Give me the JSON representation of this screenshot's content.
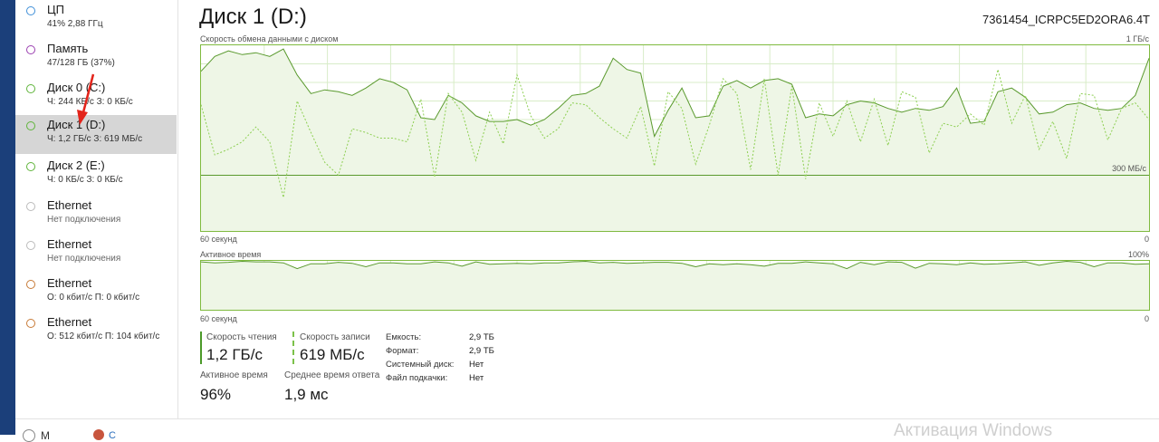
{
  "sidebar": {
    "items": [
      {
        "title": "ЦП",
        "sub": "41% 2,88 ГГц",
        "color": "#3f8fd8"
      },
      {
        "title": "Память",
        "sub": "47/128 ГБ (37%)",
        "color": "#9b3fb0"
      },
      {
        "title": "Диск 0 (C:)",
        "sub": "Ч: 244 КБ/с З: 0 КБ/с",
        "color": "#5fb43a"
      },
      {
        "title": "Диск 1 (D:)",
        "sub": "Ч: 1,2 ГБ/с З: 619 МБ/с",
        "color": "#5fb43a",
        "selected": true
      },
      {
        "title": "Диск 2 (E:)",
        "sub": "Ч: 0 КБ/с З: 0 КБ/с",
        "color": "#5fb43a"
      },
      {
        "title": "Ethernet",
        "sub": "Нет подключения",
        "color": "#bbbbbb"
      },
      {
        "title": "Ethernet",
        "sub": "Нет подключения",
        "color": "#bbbbbb"
      },
      {
        "title": "Ethernet",
        "sub": "О: 0 кбит/с П: 0 кбит/с",
        "color": "#c77a36"
      },
      {
        "title": "Ethernet",
        "sub": "О: 512 кбит/с П: 104 кбит/с",
        "color": "#c77a36"
      }
    ]
  },
  "header": {
    "title": "Диск 1 (D:)",
    "model": "7361454_ICRPC5ED2ORA6.4T"
  },
  "transfer_graph": {
    "label": "Скорость обмена данными с диском",
    "max_label": "1 ГБ/с",
    "mid_label": "300 МБ/с",
    "mid_fraction": 0.3,
    "time_label": "60 секунд",
    "zero_label": "0",
    "read_series": [
      0.86,
      0.94,
      0.97,
      0.95,
      0.96,
      0.94,
      0.98,
      0.84,
      0.74,
      0.76,
      0.75,
      0.73,
      0.77,
      0.82,
      0.8,
      0.76,
      0.61,
      0.6,
      0.73,
      0.69,
      0.62,
      0.59,
      0.59,
      0.6,
      0.57,
      0.6,
      0.66,
      0.73,
      0.74,
      0.78,
      0.93,
      0.87,
      0.85,
      0.51,
      0.65,
      0.77,
      0.61,
      0.62,
      0.78,
      0.81,
      0.77,
      0.81,
      0.82,
      0.79,
      0.61,
      0.63,
      0.62,
      0.68,
      0.7,
      0.69,
      0.66,
      0.64,
      0.66,
      0.65,
      0.67,
      0.77,
      0.58,
      0.59,
      0.75,
      0.77,
      0.72,
      0.63,
      0.64,
      0.68,
      0.69,
      0.66,
      0.65,
      0.66,
      0.73,
      0.93
    ],
    "write_series": [
      0.68,
      0.41,
      0.44,
      0.48,
      0.56,
      0.48,
      0.18,
      0.7,
      0.53,
      0.37,
      0.3,
      0.55,
      0.53,
      0.5,
      0.5,
      0.48,
      0.71,
      0.29,
      0.74,
      0.64,
      0.38,
      0.64,
      0.47,
      0.84,
      0.62,
      0.5,
      0.55,
      0.69,
      0.68,
      0.61,
      0.55,
      0.5,
      0.67,
      0.35,
      0.75,
      0.66,
      0.36,
      0.57,
      0.82,
      0.74,
      0.33,
      0.82,
      0.3,
      0.78,
      0.28,
      0.69,
      0.51,
      0.7,
      0.48,
      0.71,
      0.46,
      0.75,
      0.72,
      0.42,
      0.58,
      0.56,
      0.63,
      0.57,
      0.87,
      0.58,
      0.73,
      0.44,
      0.59,
      0.39,
      0.74,
      0.73,
      0.49,
      0.66,
      0.69,
      0.6
    ]
  },
  "active_graph": {
    "label": "Активное время",
    "max_label": "100%",
    "time_label": "60 секунд",
    "zero_label": "0",
    "series": [
      0.98,
      0.96,
      0.97,
      0.99,
      0.98,
      0.98,
      0.96,
      0.84,
      0.94,
      0.94,
      0.97,
      0.95,
      0.88,
      0.96,
      0.96,
      0.94,
      0.94,
      0.98,
      0.96,
      0.89,
      0.98,
      0.93,
      0.94,
      0.95,
      0.94,
      0.96,
      0.96,
      0.98,
      0.99,
      0.96,
      0.97,
      0.95,
      0.96,
      0.97,
      0.97,
      0.95,
      0.88,
      0.94,
      0.92,
      0.94,
      0.92,
      0.89,
      0.95,
      0.95,
      0.98,
      0.96,
      0.94,
      0.84,
      0.97,
      0.92,
      0.98,
      0.97,
      0.85,
      0.95,
      0.94,
      0.92,
      0.96,
      0.93,
      0.94,
      0.96,
      0.98,
      0.91,
      0.96,
      0.99,
      0.97,
      0.88,
      0.96,
      0.96,
      0.93,
      0.94
    ]
  },
  "stats": {
    "read_label": "Скорость чтения",
    "read_value": "1,2 ГБ/с",
    "write_label": "Скорость записи",
    "write_value": "619 МБ/с",
    "active_label": "Активное время",
    "active_value": "96%",
    "resp_label": "Среднее время ответа",
    "resp_value": "1,9 мс"
  },
  "properties": [
    {
      "label": "Емкость:",
      "value": "2,9 ТБ"
    },
    {
      "label": "Формат:",
      "value": "2,9 ТБ"
    },
    {
      "label": "Системный диск:",
      "value": "Нет"
    },
    {
      "label": "Файл подкачки:",
      "value": "Нет"
    }
  ],
  "colors": {
    "graph_line": "#7fba3f",
    "graph_fill": "#eef6e6",
    "grid": "#d8ecc8",
    "selected_bg": "#d6d6d6",
    "arrow": "#e3241b"
  },
  "footer": {
    "text": "М",
    "second": "С",
    "watermark": "Активация Windows"
  }
}
